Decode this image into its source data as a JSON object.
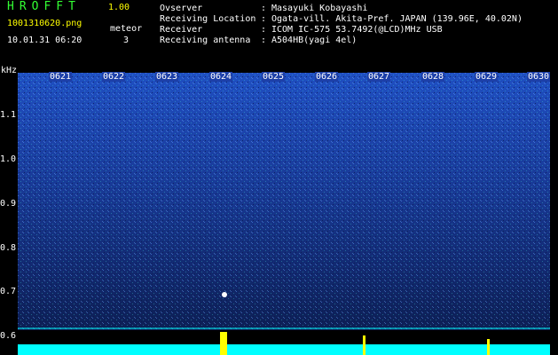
{
  "header": {
    "app_title": "HROFFT",
    "version": "1.00",
    "filename": "1001310620.png",
    "datetime": "10.01.31 06:20",
    "meteor_label": "meteor",
    "meteor_count": "3",
    "observer_label": "Ovserver",
    "observer_value": "Masayuki Kobayashi",
    "location_label": "Receiving Location",
    "location_value": "Ogata-vill. Akita-Pref. JAPAN (139.96E, 40.02N)",
    "receiver_label": "Receiver",
    "receiver_value": "ICOM IC-575 53.7492(@LCD)MHz USB",
    "antenna_label": "Receiving antenna",
    "antenna_value": "A504HB(yagi 4el)",
    "colon": ":"
  },
  "axis": {
    "y_unit": "kHz",
    "y_ticks": [
      "1.1",
      "1.0",
      "0.9",
      "0.8",
      "0.7",
      "0.6"
    ],
    "x_ticks": [
      "0621",
      "0622",
      "0623",
      "0624",
      "0625",
      "0626",
      "0627",
      "0628",
      "0629",
      "0630"
    ]
  },
  "colors": {
    "title_green": "#33ff33",
    "label_yellow": "#ffff00",
    "spectrogram_blue": "#1c43aa",
    "trace_cyan": "#00ffff",
    "meteor_yellow": "#ffff00"
  }
}
